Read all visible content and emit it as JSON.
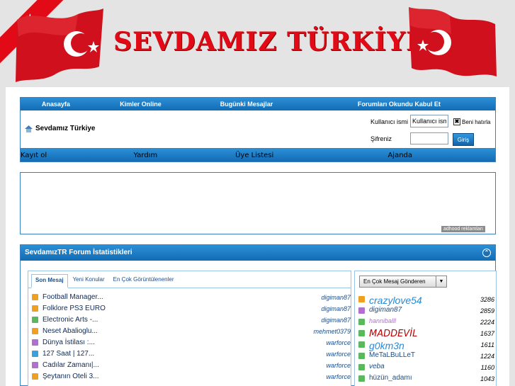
{
  "header": {
    "site_title": "SEVDAMIZ TÜRKİYE",
    "brand_red": "#e30a17"
  },
  "nav_top": [
    "Anasayfa",
    "Kimler Online",
    "Bugünki Mesajlar",
    "Forumları Okundu Kabul Et"
  ],
  "forum_name": "Sevdamız Türkiye",
  "login": {
    "username_label": "Kullanıcı ismi",
    "username_value": "Kullanıcı ism",
    "remember_label": "Beni hatırla",
    "password_label": "Şifreniz",
    "login_button": "Giriş"
  },
  "nav_bottom": [
    "Kayıt ol",
    "Yardım",
    "Üye Listesi",
    "Ajanda"
  ],
  "ad": {
    "badge": "adhood reklamları"
  },
  "stats": {
    "title": "SevdamızTR Forum İstatistikleri",
    "tabs": [
      "Son Mesaj",
      "Yeni Konular",
      "En Çok Görüntülenenler"
    ],
    "active_tab": "Son Mesaj",
    "threads": [
      {
        "title": "Football Manager...",
        "user": "digiman87",
        "icon_color": "#f0a020"
      },
      {
        "title": "Folklore PS3 EURO",
        "user": "digiman87",
        "icon_color": "#f0a020"
      },
      {
        "title": "Electronic Arts -...",
        "user": "digiman87",
        "icon_color": "#5cb85c"
      },
      {
        "title": "Neset Abalioglu...",
        "user": "mehmet0379",
        "icon_color": "#f0a020"
      },
      {
        "title": "Dünya İstilası :...",
        "user": "warforce",
        "icon_color": "#b070d0"
      },
      {
        "title": "127 Saat | 127...",
        "user": "warforce",
        "icon_color": "#3aa0e0"
      },
      {
        "title": "Cadılar Zamanı|...",
        "user": "warforce",
        "icon_color": "#b070d0"
      },
      {
        "title": "Şeytanın Oteli 3...",
        "user": "warforce",
        "icon_color": "#f0a020"
      }
    ],
    "top_posters_dropdown": "En Çok Mesaj Gönderen",
    "top_posters": [
      {
        "name": "crazylove54",
        "count": "3286",
        "color": "#2a8ad4",
        "size": "14px",
        "style": "italic",
        "weight": "normal",
        "font": "\"Liberation Sans\", sans-serif",
        "icon_color": "#f0a020"
      },
      {
        "name": "digiman87",
        "count": "2859",
        "color": "#1a4e8c",
        "size": "10px",
        "style": "italic",
        "weight": "normal",
        "font": "\"Liberation Sans\", sans-serif",
        "icon_color": "#b070d0"
      },
      {
        "name": "hanniballl",
        "count": "2224",
        "color": "#b070d0",
        "size": "9px",
        "style": "italic",
        "weight": "normal",
        "font": "\"Liberation Sans\", sans-serif",
        "icon_color": "#5cb85c"
      },
      {
        "name": "MADDEVİL",
        "count": "1637",
        "color": "#c00000",
        "size": "13px",
        "style": "italic",
        "weight": "normal",
        "font": "\"DejaVu Sans\", sans-serif",
        "icon_color": "#5cb85c"
      },
      {
        "name": "g0km3n",
        "count": "1611",
        "color": "#2a8ad4",
        "size": "14px",
        "style": "italic",
        "weight": "normal",
        "font": "\"Liberation Sans\", sans-serif",
        "icon_color": "#5cb85c"
      },
      {
        "name": "MeTaLBuLLeT",
        "count": "1224",
        "color": "#1a4e8c",
        "size": "10px",
        "style": "normal",
        "weight": "normal",
        "font": "\"Liberation Sans\", sans-serif",
        "icon_color": "#5cb85c"
      },
      {
        "name": "veba",
        "count": "1160",
        "color": "#1a4e8c",
        "size": "10px",
        "style": "italic",
        "weight": "normal",
        "font": "\"Liberation Sans\", sans-serif",
        "icon_color": "#5cb85c"
      },
      {
        "name": "hüzün_adamı",
        "count": "1043",
        "color": "#1a4e8c",
        "size": "10px",
        "style": "normal",
        "weight": "normal",
        "font": "\"Liberation Sans\", sans-serif",
        "icon_color": "#5cb85c"
      }
    ]
  }
}
